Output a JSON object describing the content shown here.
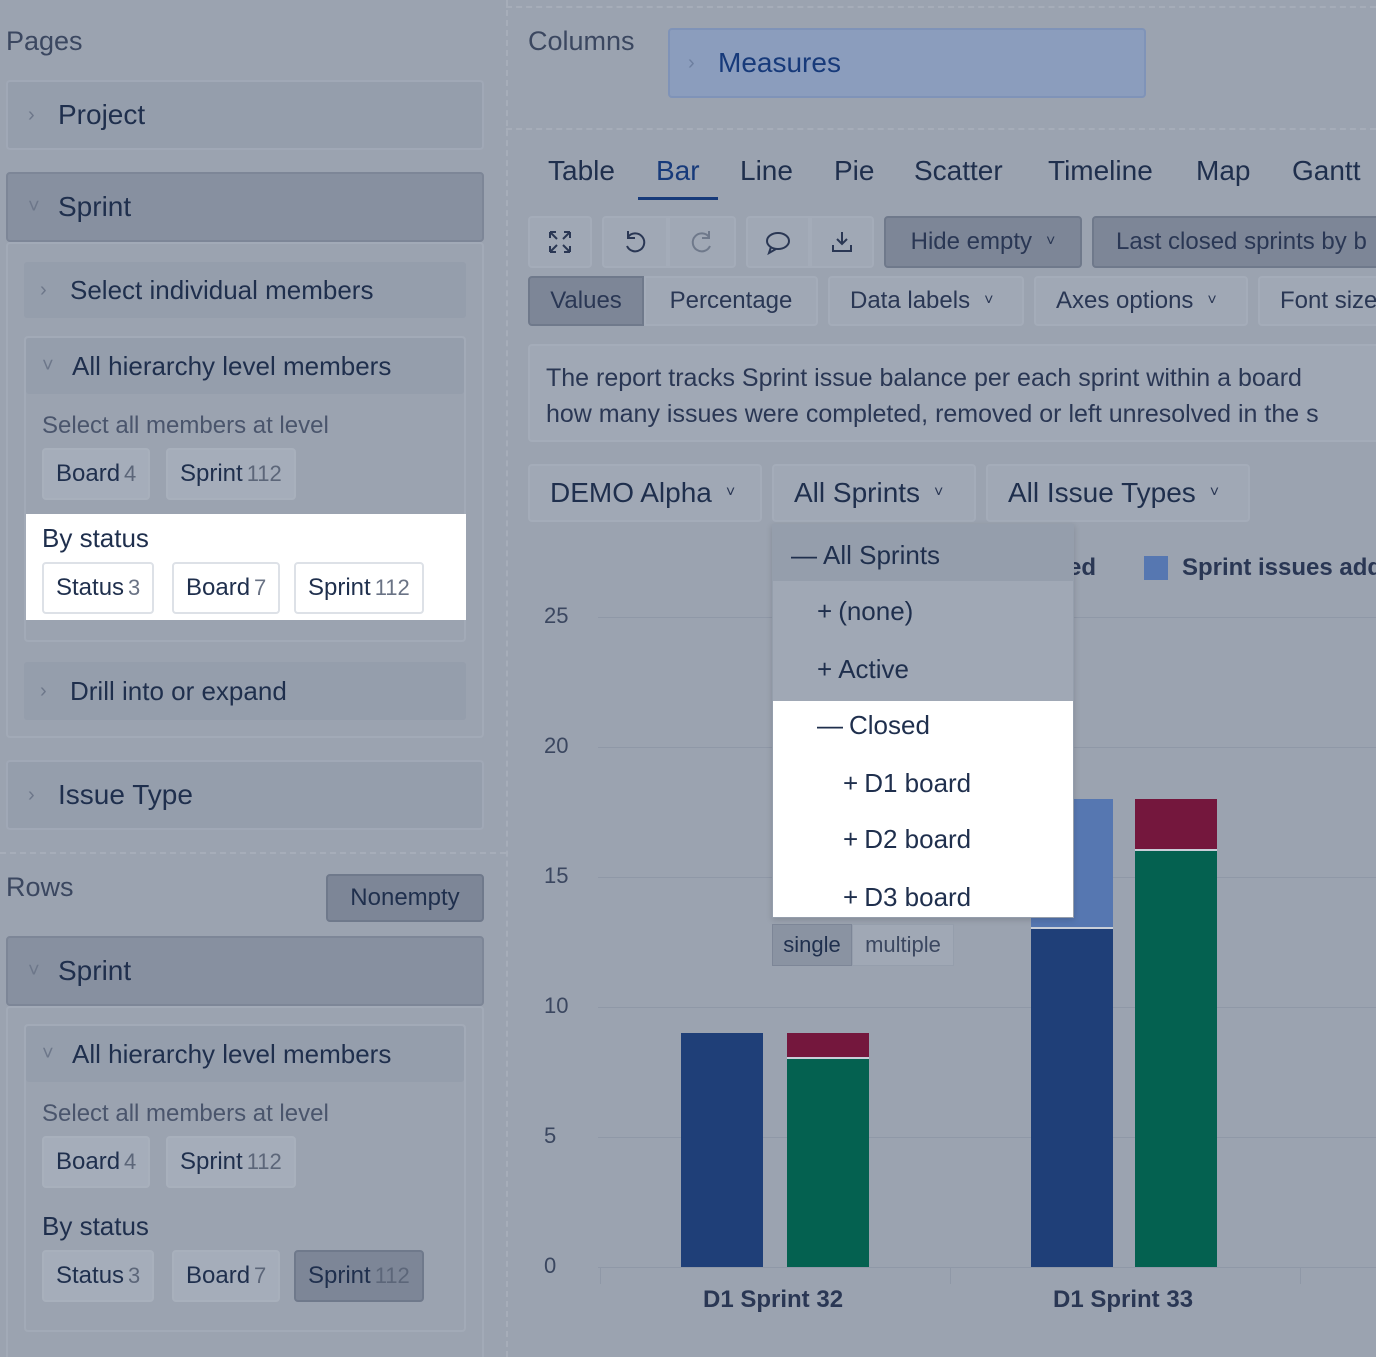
{
  "left": {
    "pages_title": "Pages",
    "project": "Project",
    "sprint": "Sprint",
    "select_individual": "Select individual members",
    "all_hierarchy": "All hierarchy level members",
    "select_all_level": "Select all members at level",
    "level_chips": [
      {
        "label": "Board",
        "count": "4"
      },
      {
        "label": "Sprint",
        "count": "112"
      }
    ],
    "by_status": "By status",
    "status_chips": [
      {
        "label": "Status",
        "count": "3"
      },
      {
        "label": "Board",
        "count": "7"
      },
      {
        "label": "Sprint",
        "count": "112"
      }
    ],
    "drill": "Drill into or expand",
    "issue_type": "Issue Type",
    "rows_title": "Rows",
    "nonempty": "Nonempty",
    "rows_sprint": "Sprint",
    "rows_all_hierarchy": "All hierarchy level members",
    "rows_select_all_level": "Select all members at level",
    "rows_level_chips": [
      {
        "label": "Board",
        "count": "4"
      },
      {
        "label": "Sprint",
        "count": "112"
      }
    ],
    "rows_by_status": "By status",
    "rows_status_chips": [
      {
        "label": "Status",
        "count": "3"
      },
      {
        "label": "Board",
        "count": "7"
      },
      {
        "label": "Sprint",
        "count": "112"
      }
    ]
  },
  "columns": {
    "title": "Columns",
    "measures": "Measures"
  },
  "tabs": [
    "Table",
    "Bar",
    "Line",
    "Pie",
    "Scatter",
    "Timeline",
    "Map",
    "Gantt"
  ],
  "active_tab": "Bar",
  "toolbar": {
    "hide_empty": "Hide empty",
    "last_closed": "Last closed sprints by b",
    "values": "Values",
    "percentage": "Percentage",
    "data_labels": "Data labels",
    "axes_options": "Axes options",
    "font_size": "Font size"
  },
  "description_line1": "The report tracks Sprint issue balance per each sprint within a board",
  "description_line2": "how many issues were completed, removed or left unresolved in the s",
  "filters": {
    "project": "DEMO Alpha",
    "sprints": "All Sprints",
    "issue_types": "All Issue Types"
  },
  "dropdown": {
    "items": [
      {
        "sign": "—",
        "label": "All Sprints"
      },
      {
        "sign": "+",
        "label": "(none)"
      },
      {
        "sign": "+",
        "label": "Active"
      },
      {
        "sign": "—",
        "label": "Closed"
      },
      {
        "sign": "+",
        "label": "D1 board"
      },
      {
        "sign": "+",
        "label": "D2 board"
      },
      {
        "sign": "+",
        "label": "D3 board"
      }
    ],
    "single": "single",
    "multiple": "multiple"
  },
  "legend": {
    "partial": "ed",
    "series": "Sprint issues add"
  },
  "colors": {
    "navy": "#1f3f78",
    "green": "#046150",
    "maroon": "#74173d",
    "blue": "#5677b1"
  },
  "chart_data": {
    "type": "bar",
    "categories": [
      "D1 Sprint 32",
      "D1 Sprint 33"
    ],
    "yticks": [
      "0",
      "5",
      "10",
      "15",
      "20",
      "25"
    ],
    "ylim": [
      0,
      25
    ],
    "stacks": [
      [
        {
          "color": "navy",
          "value": 9
        }
      ],
      [
        {
          "color": "green",
          "value": 8
        },
        {
          "color": "maroon",
          "value": 1
        }
      ],
      [
        {
          "color": "navy",
          "value": 13
        },
        {
          "color": "blue",
          "value": 5
        }
      ],
      [
        {
          "color": "green",
          "value": 16
        },
        {
          "color": "maroon",
          "value": 2
        }
      ]
    ]
  }
}
